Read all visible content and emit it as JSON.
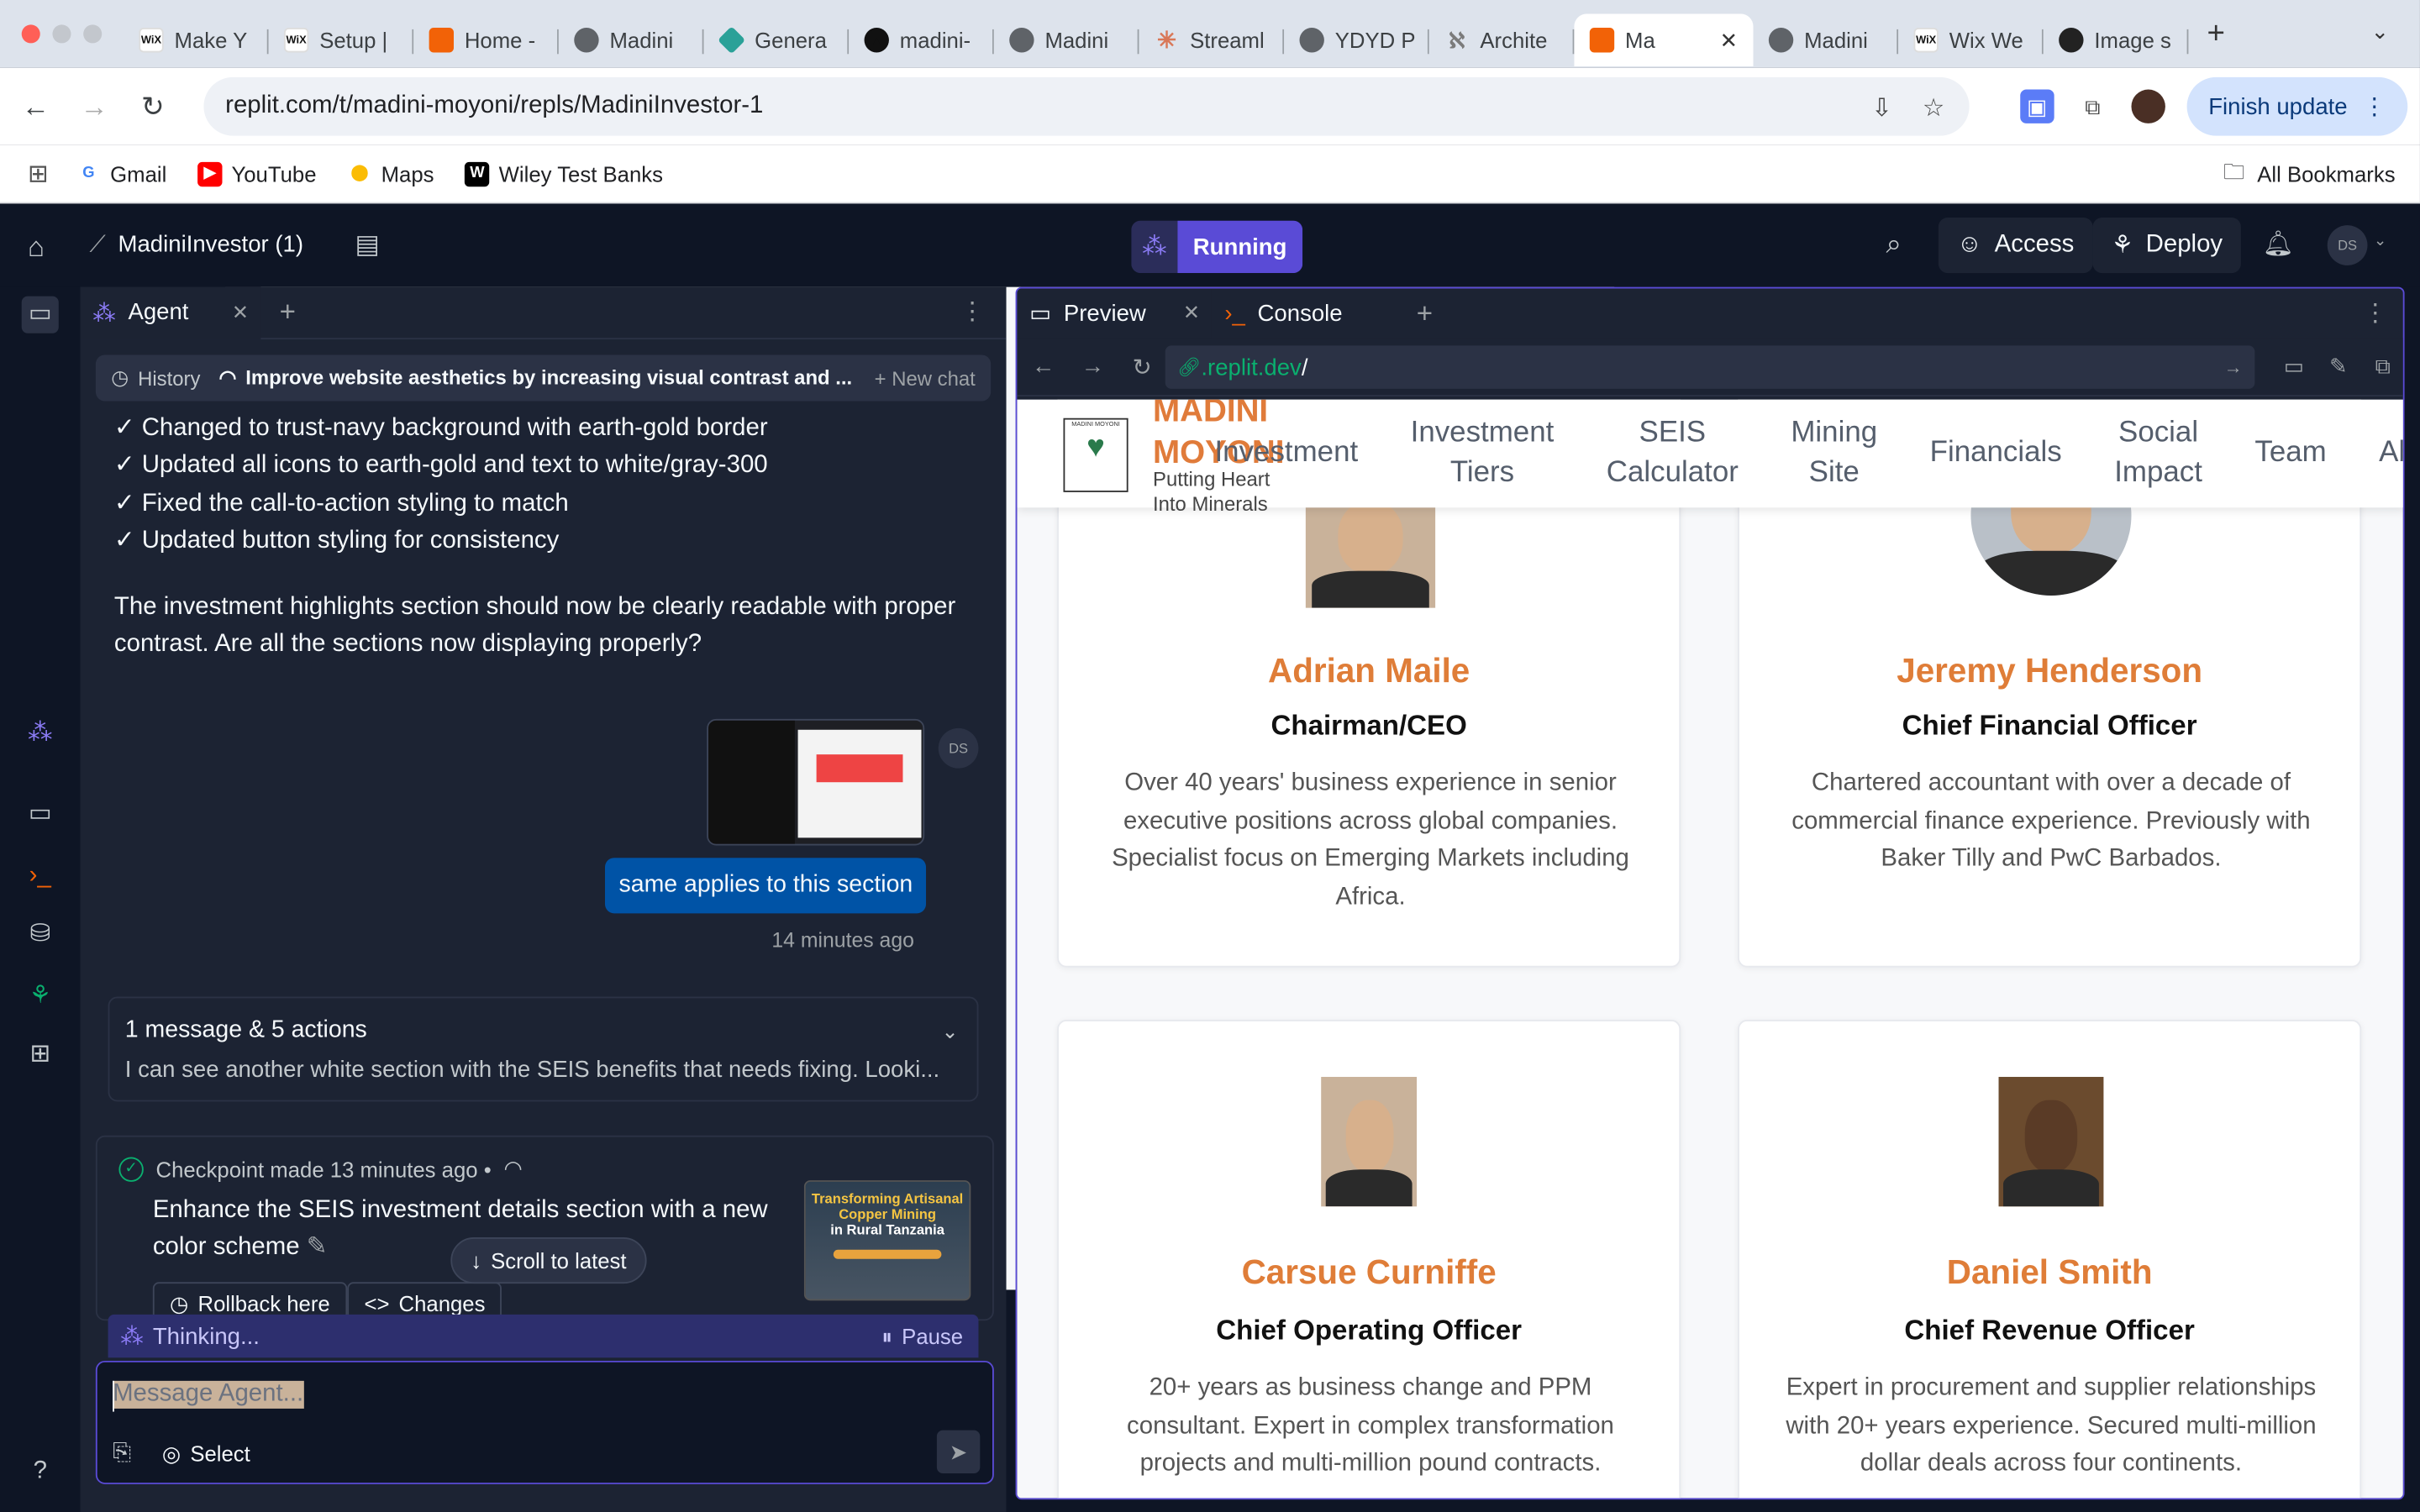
{
  "browser": {
    "tabs": [
      {
        "title": "Make Y",
        "fav": "wix"
      },
      {
        "title": "Setup |",
        "fav": "wix"
      },
      {
        "title": "Home -",
        "fav": "rep"
      },
      {
        "title": "Madini",
        "fav": "globe"
      },
      {
        "title": "Genera",
        "fav": "dia"
      },
      {
        "title": "madini-",
        "fav": "tri"
      },
      {
        "title": "Madini",
        "fav": "globe"
      },
      {
        "title": "Streaml",
        "fav": "star"
      },
      {
        "title": "YDYD P",
        "fav": "globe"
      },
      {
        "title": "Archite",
        "fav": "arch"
      },
      {
        "title": "Ma",
        "fav": "rep",
        "active": true
      },
      {
        "title": "Madini",
        "fav": "globe"
      },
      {
        "title": "Wix We",
        "fav": "wix"
      },
      {
        "title": "Image s",
        "fav": "cam"
      }
    ],
    "url": "replit.com/t/madini-moyoni/repls/MadiniInvestor-1",
    "finish_update": "Finish update",
    "bookmarks": [
      {
        "label": "Gmail",
        "icon": "google-icon",
        "color": "#4285f4"
      },
      {
        "label": "YouTube",
        "icon": "youtube-icon",
        "color": "#ff0000"
      },
      {
        "label": "Maps",
        "icon": "maps-pin-icon",
        "color": "#fbbc04"
      },
      {
        "label": "Wiley Test Banks",
        "icon": "wiley-icon",
        "color": "#000000"
      }
    ],
    "all_bookmarks": "All Bookmarks"
  },
  "replit": {
    "project_name": "MadiniInvestor (1)",
    "status": "Running",
    "access_label": "Access",
    "deploy_label": "Deploy",
    "user_initials": "DS",
    "accent": "#5a4bd6"
  },
  "agent": {
    "tab_label": "Agent",
    "history_label": "History",
    "chat_title": "Improve website aesthetics by increasing visual contrast and ...",
    "new_chat_label": "New chat",
    "checklist": [
      "✓ Changed to trust-navy background with earth-gold border",
      "✓ Updated all icons to earth-gold and text to white/gray-300",
      "✓ Fixed the call-to-action styling to match",
      "✓ Updated button styling for consistency"
    ],
    "paragraph": "The investment highlights section should now be clearly readable with proper contrast. Are all the sections now displaying properly?",
    "user_initials": "DS",
    "user_message": "same applies to this section",
    "user_message_time": "14 minutes ago",
    "actions_title": "1 message & 5 actions",
    "actions_preview": "I can see another white section with the SEIS benefits that needs fixing. Looki...",
    "checkpoint_header": "Checkpoint made 13 minutes ago •",
    "checkpoint_desc": "Enhance the SEIS investment details section with a new color scheme",
    "checkpoint_thumb_title": "Transforming Artisanal Copper Mining",
    "checkpoint_thumb_sub": "in Rural Tanzania",
    "rollback_label": "Rollback here",
    "changes_label": "Changes",
    "scroll_latest": "Scroll to latest",
    "thinking": "Thinking...",
    "pause": "Pause",
    "input_placeholder": "Message Agent...",
    "select_label": "Select"
  },
  "preview": {
    "tab_preview": "Preview",
    "tab_console": "Console",
    "url_domain": ".replit.dev",
    "url_path": "/"
  },
  "site": {
    "brand": "MADINI MOYONI",
    "tagline": "Putting Heart Into Minerals",
    "nav": [
      "Investment",
      "Investment\nTiers",
      "SEIS\nCalculator",
      "Mining\nSite",
      "Financials",
      "Social\nImpact",
      "Team",
      "Ab"
    ],
    "team": [
      {
        "name": "Adrian Maile",
        "role": "Chairman/CEO",
        "bio": "Over 40 years' business experience in senior executive positions across global companies. Specialist focus on Emerging Markets including Africa."
      },
      {
        "name": "Jeremy Henderson",
        "role": "Chief Financial Officer",
        "bio": "Chartered accountant with over a decade of commercial finance experience. Previously with Baker Tilly and PwC Barbados."
      },
      {
        "name": "Carsue Curniffe",
        "role": "Chief Operating Officer",
        "bio": "20+ years as business change and PPM consultant. Expert in complex transformation projects and multi-million pound contracts."
      },
      {
        "name": "Daniel Smith",
        "role": "Chief Revenue Officer",
        "bio": "Expert in procurement and supplier relationships with 20+ years experience. Secured multi-million dollar deals across four continents."
      }
    ],
    "name_color": "#df7d38"
  }
}
